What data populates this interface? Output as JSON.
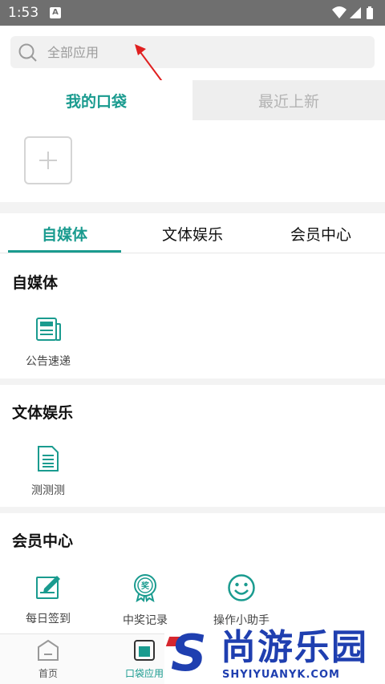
{
  "status_bar": {
    "time": "1:53",
    "notification_icon": "A"
  },
  "search": {
    "placeholder": "全部应用"
  },
  "pocket_tabs": {
    "mine": "我的口袋",
    "recent": "最近上新"
  },
  "categories": {
    "tabs": [
      "自媒体",
      "文体娱乐",
      "会员中心"
    ],
    "active": 0
  },
  "sections": [
    {
      "title": "自媒体",
      "apps": [
        {
          "label": "公告速递",
          "icon": "news-icon"
        }
      ]
    },
    {
      "title": "文体娱乐",
      "apps": [
        {
          "label": "测测测",
          "icon": "document-icon"
        }
      ]
    },
    {
      "title": "会员中心",
      "apps": [
        {
          "label": "每日签到",
          "icon": "sign-in-icon"
        },
        {
          "label": "中奖记录",
          "icon": "prize-medal-icon"
        },
        {
          "label": "操作小助手",
          "icon": "smiley-icon"
        }
      ]
    }
  ],
  "bottom_nav": {
    "home": "首页",
    "pocket": "口袋应用"
  },
  "watermark": {
    "letter": "S",
    "chinese": "尚游乐园",
    "english": "SHYIYUANYK.COM"
  },
  "colors": {
    "accent": "#1a9b8f",
    "status_bar": "#6f6f6f",
    "watermark_blue": "#1f3fb0",
    "watermark_red": "#d6262e"
  }
}
